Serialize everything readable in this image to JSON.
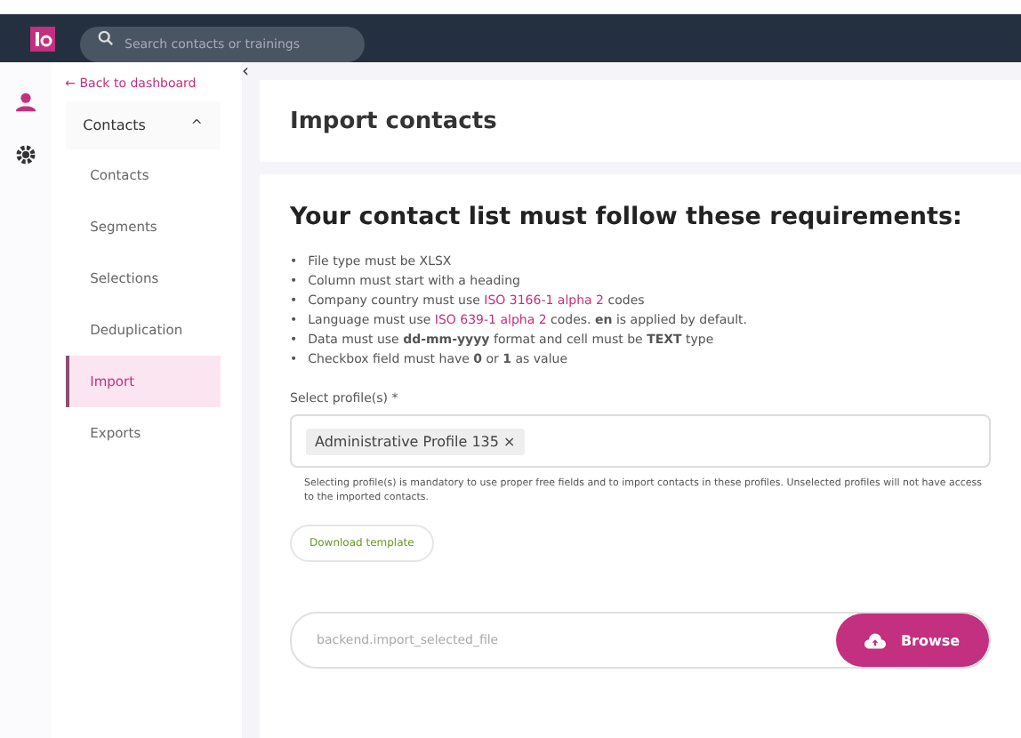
{
  "topbar": {
    "search": {
      "placeholder": "Search contacts or trainings"
    }
  },
  "sidebar": {
    "back_link": "← Back to dashboard",
    "group": {
      "label": "Contacts",
      "expanded": true,
      "caret": "^"
    },
    "items": [
      {
        "label": "Contacts",
        "selected": false
      },
      {
        "label": "Segments",
        "selected": false
      },
      {
        "label": "Selections",
        "selected": false
      },
      {
        "label": "Deduplication",
        "selected": false
      },
      {
        "label": "Import",
        "selected": true
      },
      {
        "label": "Exports",
        "selected": false
      }
    ],
    "collapse": "‹"
  },
  "header": {
    "title": "Import contacts"
  },
  "requirements": {
    "title": "Your contact list must follow these requirements:",
    "bullet": "•",
    "items": [
      [
        {
          "kind": "text",
          "text": "File type must be XLSX"
        }
      ],
      [
        {
          "kind": "text",
          "text": "Column must start with a heading"
        }
      ],
      [
        {
          "kind": "text",
          "text": "Company country must use "
        },
        {
          "kind": "link",
          "text": "ISO 3166-1 alpha 2"
        },
        {
          "kind": "text",
          "text": " codes"
        }
      ],
      [
        {
          "kind": "text",
          "text": "Language must use "
        },
        {
          "kind": "link",
          "text": "ISO 639-1 alpha 2"
        },
        {
          "kind": "text",
          "text": " codes. **en** is applied by default."
        }
      ],
      [
        {
          "kind": "text",
          "text": "Data must use **dd-mm-yyyy** format and cell must be **TEXT** type"
        }
      ],
      [
        {
          "kind": "text",
          "text": "Checkbox field must have **0** or **1** as value"
        }
      ]
    ]
  },
  "profiles": {
    "label": "Select profile(s) *",
    "tags": [
      {
        "label": "Administrative Profile 135",
        "remove": "×"
      }
    ],
    "help": "Selecting profile(s) is mandatory to use proper free fields and to import contacts in these profiles. Unselected profiles will not have access to the imported contacts."
  },
  "download_button": "Download template",
  "file": {
    "placeholder": "backend.import_selected_file",
    "button": "Browse"
  }
}
